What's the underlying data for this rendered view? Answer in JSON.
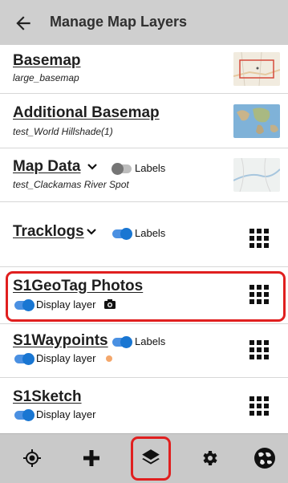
{
  "header": {
    "title": "Manage Map Layers"
  },
  "layers": [
    {
      "title": "Basemap",
      "subtitle": "large_basemap"
    },
    {
      "title": "Additional Basemap",
      "subtitle": "test_World Hillshade(1)"
    },
    {
      "title": "Map Data",
      "subtitle": "test_Clackamas River Spot",
      "toggle_label": "Labels",
      "toggle_on": false
    },
    {
      "title": "Tracklogs",
      "toggle_label": "Labels",
      "toggle_on": true
    },
    {
      "title": "S1GeoTag Photos",
      "toggle_label": "Display layer",
      "toggle_on": true
    },
    {
      "title": "S1Waypoints",
      "toggle_label": "Labels",
      "toggle_on": true,
      "toggle2_label": "Display layer",
      "point_color": "#f4a76b"
    },
    {
      "title": "S1Sketch",
      "toggle_label": "Display layer",
      "toggle_on": true
    }
  ],
  "bottom_nav": [
    "gps-target-icon",
    "add-icon",
    "layers-icon",
    "settings-icon",
    "globe-icon"
  ],
  "colors": {
    "accent": "#1976d2",
    "highlight": "#e01f1f",
    "header_bg": "#cfcfcf",
    "bar_bg": "#c9c9c9"
  }
}
